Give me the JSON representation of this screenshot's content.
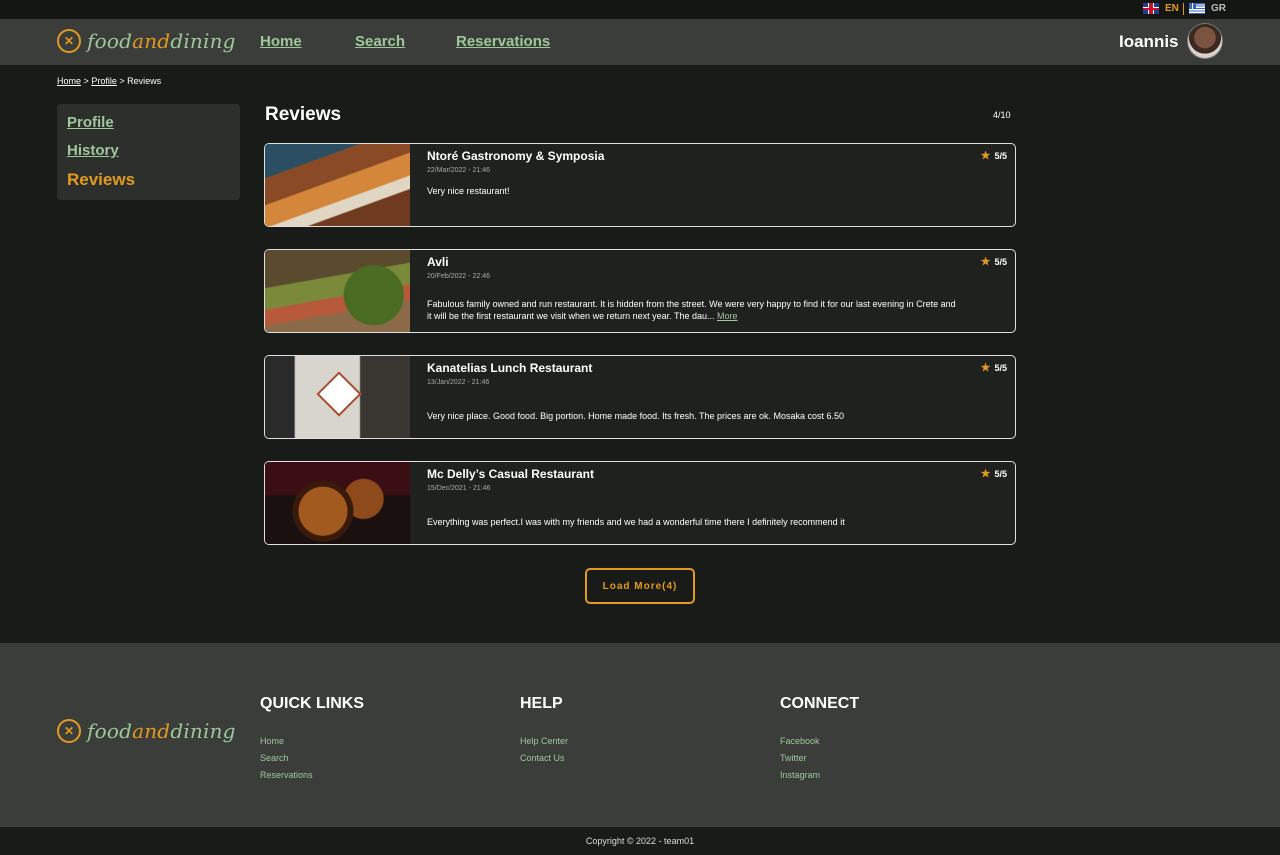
{
  "lang": {
    "en": "EN",
    "gr": "GR"
  },
  "brand": {
    "part1": "food",
    "part2": "and",
    "part3": "dining"
  },
  "nav": {
    "home": "Home",
    "search": "Search",
    "reservations": "Reservations"
  },
  "user": {
    "name": "Ioannis"
  },
  "breadcrumb": {
    "home": "Home",
    "profile": "Profile",
    "current": "Reviews",
    "sep": ">"
  },
  "sidebar": {
    "profile": "Profile",
    "history": "History",
    "reviews": "Reviews"
  },
  "main": {
    "title": "Reviews",
    "counter": "4/10"
  },
  "reviews": [
    {
      "name": "Ntoré Gastronomy & Symposia",
      "date": "22/Mar/2022 - 21:46",
      "text": "Very nice restaurant!",
      "rating": "5/5",
      "more": ""
    },
    {
      "name": "Avli",
      "date": "20/Feb/2022 - 22:46",
      "text": "Fabulous family owned and run restaurant. It is hidden from the street. We were very happy to find it for our last evening in Crete and it will be the first restaurant we visit when we return next year. The dau...",
      "rating": "5/5",
      "more": "More"
    },
    {
      "name": "Kanatelias Lunch Restaurant",
      "date": "13/Jan/2022 - 21:46",
      "text": "Very nice place. Good food. Big portion. Home made food. Its fresh. The prices are ok. Mosaka cost 6.50",
      "rating": "5/5",
      "more": ""
    },
    {
      "name": "Mc Delly’s Casual Restaurant",
      "date": "15/Dec/2021 - 21:46",
      "text": "Everything was perfect.I was with my friends and we had a wonderful time there I definitely recommend it",
      "rating": "5/5",
      "more": ""
    }
  ],
  "load_more": "Load More(4)",
  "footer": {
    "quick_links": {
      "title": "QUICK LINKS",
      "items": [
        "Home",
        "Search",
        "Reservations"
      ]
    },
    "help": {
      "title": "HELP",
      "items": [
        "Help Center",
        "Contact Us"
      ]
    },
    "connect": {
      "title": "CONNECT",
      "items": [
        "Facebook",
        "Twitter",
        "Instagram"
      ]
    },
    "copyright": "Copyright © 2022 - team01"
  },
  "colors": {
    "accent": "#e39a1e",
    "green": "#9fc89a",
    "header_bg": "#3a3d3a",
    "page_bg": "#181b18"
  }
}
